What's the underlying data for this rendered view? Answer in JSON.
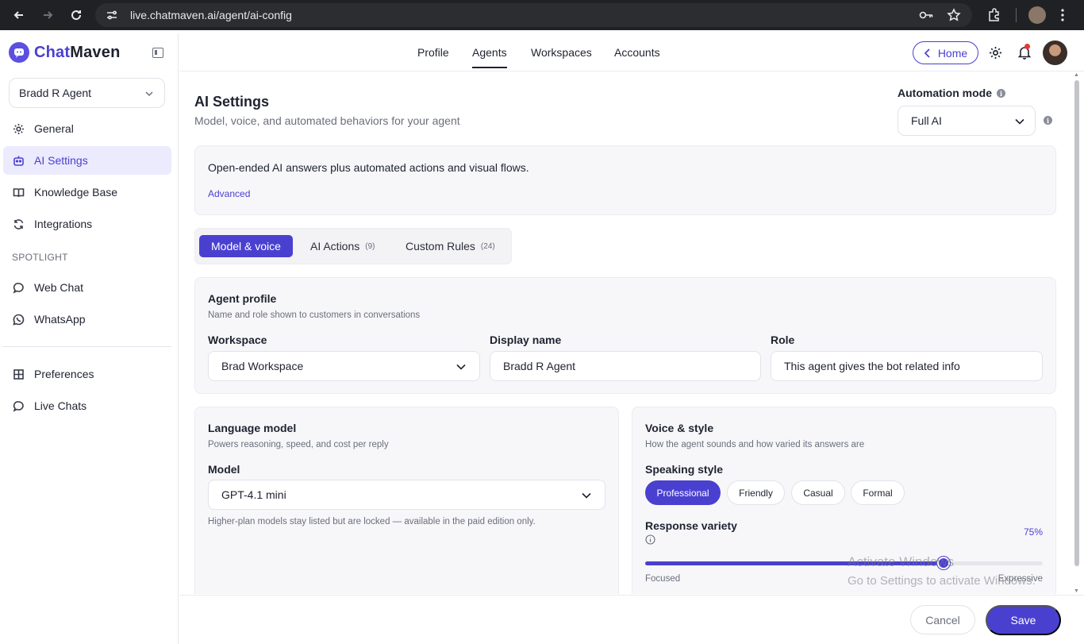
{
  "browser": {
    "url": "live.chatmaven.ai/agent/ai-config"
  },
  "brand": {
    "name_prefix": "Chat",
    "name_suffix": "Maven"
  },
  "sidebar": {
    "agent_select": "Bradd R Agent",
    "items": [
      {
        "label": "General",
        "icon": "gear-icon"
      },
      {
        "label": "AI Settings",
        "icon": "robot-icon",
        "active": true
      },
      {
        "label": "Knowledge Base",
        "icon": "book-icon"
      },
      {
        "label": "Integrations",
        "icon": "refresh-icon"
      }
    ],
    "spotlight_heading": "SPOTLIGHT",
    "spotlight_items": [
      {
        "label": "Web Chat",
        "icon": "chat-bubble-icon"
      },
      {
        "label": "WhatsApp",
        "icon": "whatsapp-icon"
      }
    ],
    "bottom_items": [
      {
        "label": "Preferences",
        "icon": "grid-icon"
      },
      {
        "label": "Live Chats",
        "icon": "chat-dots-icon"
      }
    ]
  },
  "topnav": {
    "tabs": [
      "Profile",
      "Agents",
      "Workspaces",
      "Accounts"
    ],
    "active_tab": "Agents",
    "home_label": "Home"
  },
  "page": {
    "title": "AI Settings",
    "subtitle": "Model, voice, and automated behaviors for your agent",
    "automation_label": "Automation mode",
    "automation_value": "Full AI",
    "mode_description": "Open-ended AI answers plus automated actions and visual flows.",
    "mode_link": "Advanced"
  },
  "tabs": [
    {
      "label": "Model & voice",
      "count": ""
    },
    {
      "label": "AI Actions",
      "count": "(9)"
    },
    {
      "label": "Custom Rules",
      "count": "(24)"
    }
  ],
  "agent_profile": {
    "heading": "Agent profile",
    "subheading": "Name and role shown to customers in conversations",
    "workspace_label": "Workspace",
    "workspace_value": "Brad Workspace",
    "display_name_label": "Display name",
    "display_name_value": "Bradd R Agent",
    "role_label": "Role",
    "role_value": "This agent gives the bot related info"
  },
  "language_model": {
    "heading": "Language model",
    "subheading": "Powers reasoning, speed, and cost per reply",
    "model_label": "Model",
    "model_value": "GPT-4.1 mini",
    "note": "Higher-plan models stay listed but are locked — available in the paid edition only."
  },
  "voice_style": {
    "heading": "Voice & style",
    "subheading": "How the agent sounds and how varied its answers are",
    "speaking_label": "Speaking style",
    "styles": [
      "Professional",
      "Friendly",
      "Casual",
      "Formal"
    ],
    "selected_style": "Professional",
    "variety_label": "Response variety",
    "variety_value_text": "75%",
    "variety_value": 0.75,
    "min_label": "Focused",
    "max_label": "Expressive"
  },
  "footer": {
    "cancel": "Cancel",
    "save": "Save"
  },
  "watermark": {
    "line1": "Activate Windows",
    "line2": "Go to Settings to activate Windows."
  },
  "colors": {
    "accent": "#4a40d0",
    "browser_bar": "#202124",
    "card_bg": "#f7f7fa"
  }
}
